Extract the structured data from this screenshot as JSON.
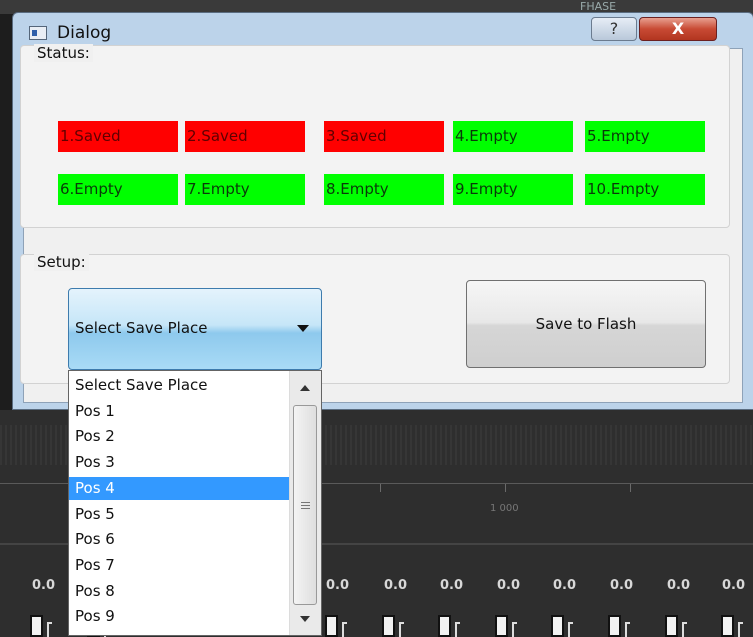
{
  "background": {
    "top_label": "FHASE",
    "ruler_label": "1 000",
    "values": [
      "0.0",
      "0.0",
      "0.0",
      "0.0",
      "0.0",
      "0.0",
      "0.0",
      "0.0",
      "0.0",
      "0.0"
    ]
  },
  "window": {
    "title": "Dialog",
    "help_label": "?",
    "close_label": "X"
  },
  "status": {
    "label": "Status:",
    "slots": [
      {
        "text": "1.Saved",
        "state": "saved"
      },
      {
        "text": "2.Saved",
        "state": "saved"
      },
      {
        "text": "3.Saved",
        "state": "saved"
      },
      {
        "text": "4.Empty",
        "state": "empty"
      },
      {
        "text": "5.Empty",
        "state": "empty"
      },
      {
        "text": "6.Empty",
        "state": "empty"
      },
      {
        "text": "7.Empty",
        "state": "empty"
      },
      {
        "text": "8.Empty",
        "state": "empty"
      },
      {
        "text": "9.Empty",
        "state": "empty"
      },
      {
        "text": "10.Empty",
        "state": "empty"
      }
    ],
    "colors": {
      "saved": "#ff0000",
      "empty": "#00ff00"
    }
  },
  "setup": {
    "label": "Setup:",
    "combo_value": "Select Save Place",
    "save_button_label": "Save to Flash"
  },
  "dropdown": {
    "options": [
      "Select Save Place",
      "Pos 1",
      "Pos 2",
      "Pos 3",
      "Pos 4",
      "Pos 5",
      "Pos 6",
      "Pos 7",
      "Pos 8",
      "Pos 9"
    ],
    "highlighted": "Pos 4",
    "highlight_color": "#3399ff"
  }
}
